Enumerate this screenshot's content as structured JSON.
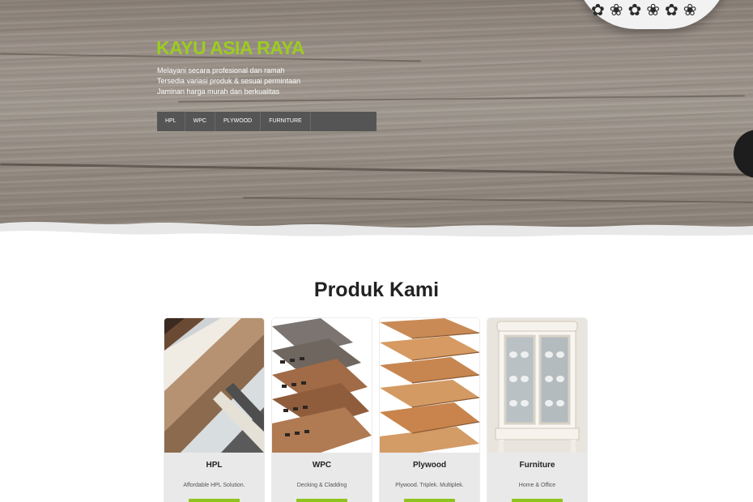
{
  "hero": {
    "brand": "KAYU ASIA RAYA",
    "taglines": [
      "Melayani secara profesional dan ramah",
      "Tersedia variasi produk & sesuai permintaan",
      "Jaminan harga murah dan berkualitas"
    ],
    "nav": [
      "HPL",
      "WPC",
      "PLYWOOD",
      "FURNITURE"
    ]
  },
  "products": {
    "title": "Produk Kami",
    "items": [
      {
        "name": "HPL",
        "desc": "Affordable HPL Solution."
      },
      {
        "name": "WPC",
        "desc": "Decking & Cladding"
      },
      {
        "name": "Plywood",
        "desc": "Plywood. Triplek. Multiplek."
      },
      {
        "name": "Furniture",
        "desc": "Home & Office"
      }
    ]
  },
  "colors": {
    "brand_green": "#9ccc1f",
    "button_green": "#8fc31f",
    "nav_bg": "#555555"
  }
}
